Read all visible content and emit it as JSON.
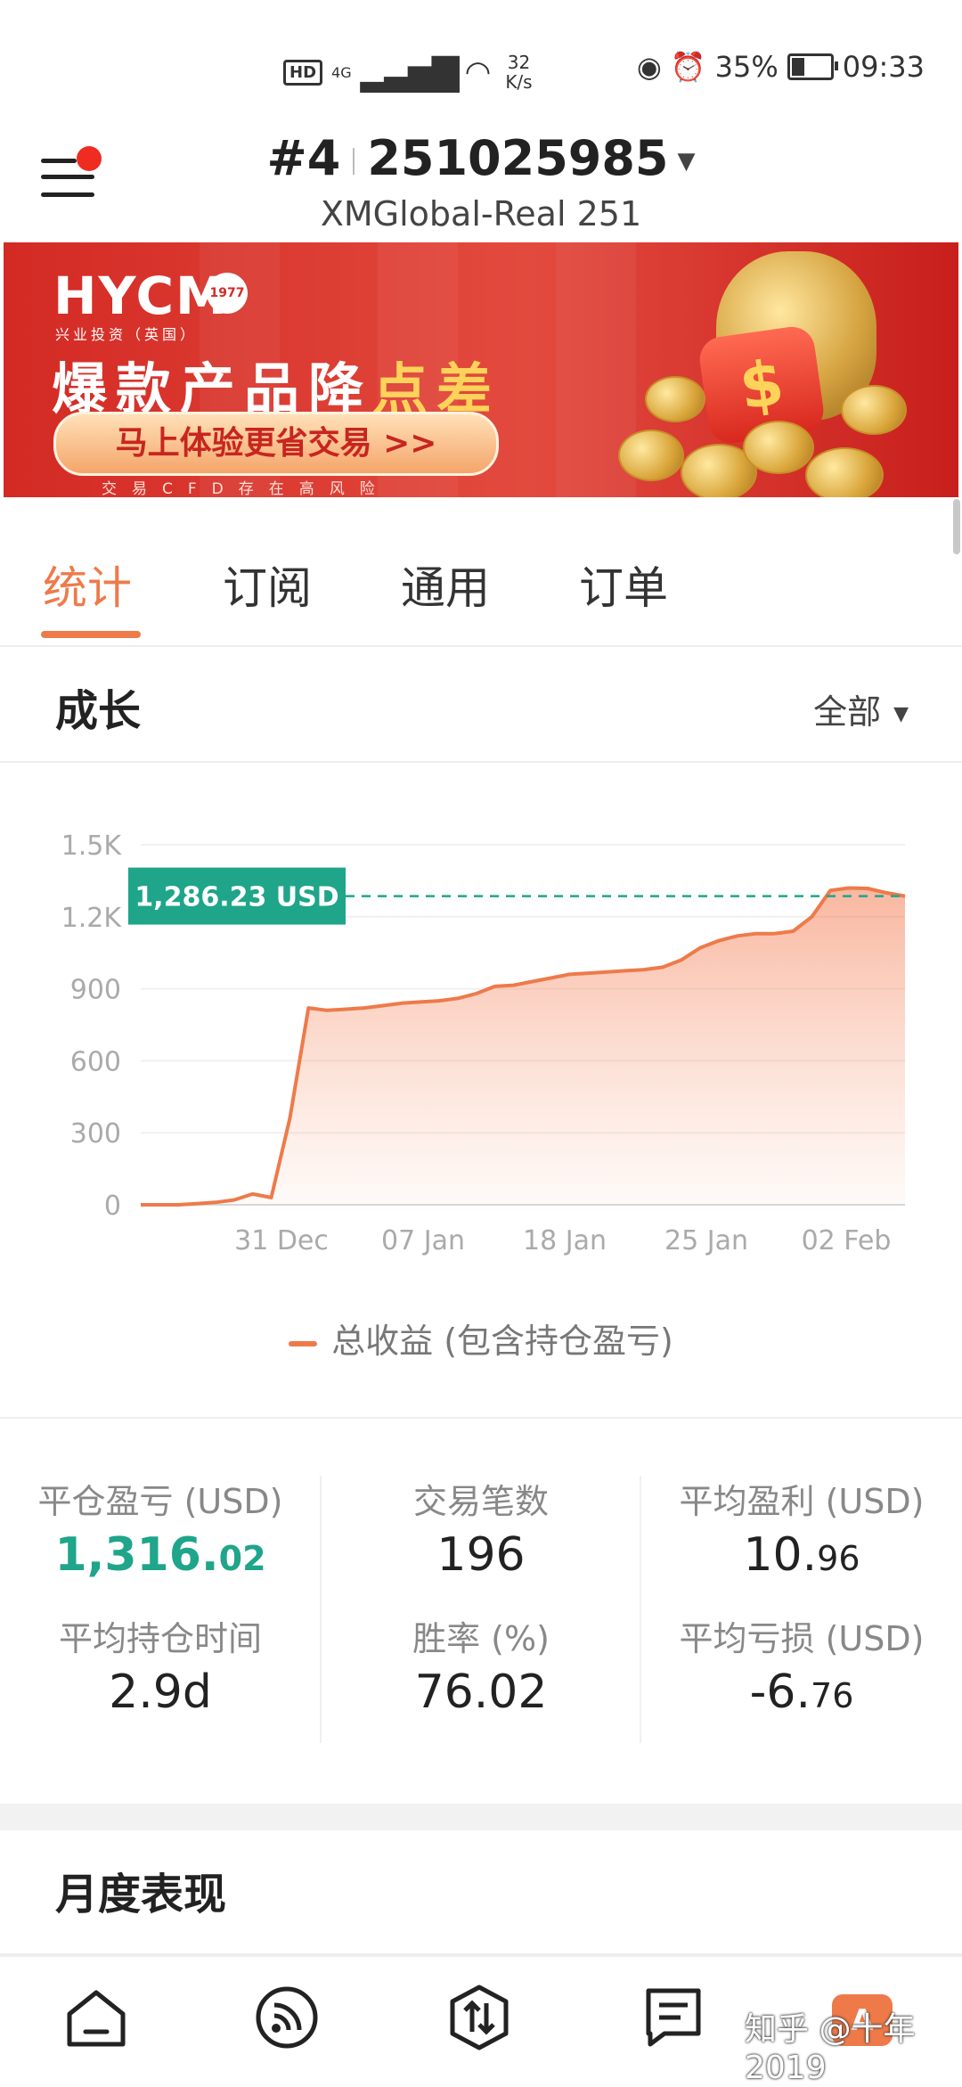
{
  "status_bar": {
    "hd": "HD",
    "network": "4G",
    "speed_value": "32",
    "speed_unit": "K/s",
    "battery_percent": "35%",
    "battery_level": 0.35,
    "time": "09:33"
  },
  "header": {
    "account_index": "#4",
    "account_number": "251025985",
    "server": "XMGlobal-Real 251"
  },
  "banner": {
    "brand": "HYCM",
    "seal": "1977",
    "brand_sub": "兴业投资（英国）",
    "headline_prefix": "爆款产品降",
    "headline_highlight": "点差",
    "cta": "马上体验更省交易 >>",
    "risk_note": "交易CFD存在高风险"
  },
  "tabs": [
    {
      "label": "统计",
      "active": true
    },
    {
      "label": "订阅",
      "active": false
    },
    {
      "label": "通用",
      "active": false
    },
    {
      "label": "订单",
      "active": false
    }
  ],
  "growth": {
    "title": "成长",
    "range": "全部"
  },
  "chart_data": {
    "type": "area",
    "current_label": "1,286.23 USD",
    "current_value": 1286.23,
    "ylim": [
      0,
      1500
    ],
    "y_ticks": [
      {
        "value": 0,
        "label": "0"
      },
      {
        "value": 300,
        "label": "300"
      },
      {
        "value": 600,
        "label": "600"
      },
      {
        "value": 900,
        "label": "900"
      },
      {
        "value": 1200,
        "label": "1.2K"
      },
      {
        "value": 1500,
        "label": "1.5K"
      }
    ],
    "x_ticks": [
      "31 Dec",
      "07 Jan",
      "18 Jan",
      "25 Jan",
      "02 Feb"
    ],
    "series": [
      {
        "name": "总收益 (包含持仓盈亏)",
        "color": "#ee7a4a",
        "values": [
          0,
          0,
          0,
          5,
          10,
          20,
          45,
          30,
          360,
          820,
          810,
          815,
          820,
          830,
          840,
          845,
          850,
          860,
          880,
          910,
          915,
          930,
          945,
          960,
          965,
          970,
          975,
          980,
          990,
          1020,
          1070,
          1100,
          1120,
          1130,
          1130,
          1140,
          1200,
          1310,
          1320,
          1318,
          1300,
          1286.23
        ]
      }
    ],
    "legend": "总收益 (包含持仓盈亏)",
    "grid": true
  },
  "stats": [
    {
      "label": "平仓盈亏 (USD)",
      "value_main": "1,316.",
      "value_small": "02",
      "positive": true
    },
    {
      "label": "交易笔数",
      "value_main": "196",
      "value_small": "",
      "positive": false
    },
    {
      "label": "平均盈利 (USD)",
      "value_main": "10.",
      "value_small": "96",
      "positive": false
    },
    {
      "label": "平均持仓时间",
      "value_main": "2.9d",
      "value_small": "",
      "positive": false
    },
    {
      "label": "胜率 (%)",
      "value_main": "76.02",
      "value_small": "",
      "positive": false
    },
    {
      "label": "平均亏损 (USD)",
      "value_main": "-6.",
      "value_small": "76",
      "positive": false
    }
  ],
  "monthly": {
    "title": "月度表现"
  },
  "bottom_nav": {
    "items": [
      "home-icon",
      "signal-feed-icon",
      "trade-icon",
      "news-icon"
    ],
    "badge": "A",
    "watermark": "知乎 @十年2019"
  },
  "colors": {
    "accent": "#ee7a4a",
    "positive": "#1fa58a",
    "banner_red": "#d32a24"
  }
}
